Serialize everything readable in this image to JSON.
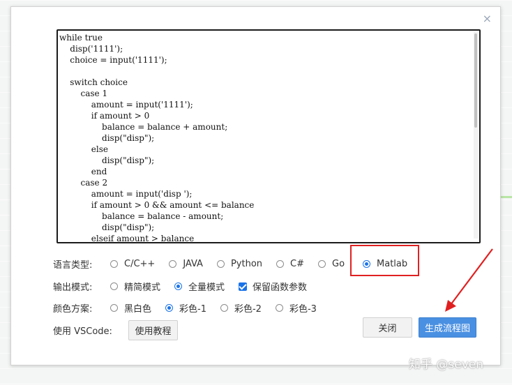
{
  "dialog": {
    "close_symbol": "×",
    "code": "while true\n    disp('1111');\n    choice = input('1111');\n\n    switch choice\n        case 1\n            amount = input('1111');\n            if amount > 0\n                balance = balance + amount;\n                disp(\"disp\");\n            else\n                disp(\"disp\");\n            end\n        case 2\n            amount = input('disp ');\n            if amount > 0 && amount <= balance\n                balance = balance - amount;\n                disp(\"disp\");\n            elseif amount > balance"
  },
  "language": {
    "label": "语言类型:",
    "options": [
      "C/C++",
      "JAVA",
      "Python",
      "C#",
      "Go",
      "Matlab"
    ],
    "selected": "Matlab"
  },
  "output_mode": {
    "label": "输出模式:",
    "options": [
      "精简模式",
      "全量模式"
    ],
    "selected": "全量模式",
    "checkbox_label": "保留函数参数",
    "checkbox_checked": true
  },
  "color_scheme": {
    "label": "颜色方案:",
    "options": [
      "黑白色",
      "彩色-1",
      "彩色-2",
      "彩色-3"
    ],
    "selected": "彩色-1"
  },
  "vscode": {
    "label": "使用 VSCode:",
    "tutorial_button": "使用教程"
  },
  "buttons": {
    "close": "关闭",
    "generate": "生成流程图"
  },
  "watermark": "知乎 @seven",
  "colors": {
    "accent": "#1a73e8",
    "primary_button": "#4a90e2",
    "highlight": "#e02020"
  }
}
